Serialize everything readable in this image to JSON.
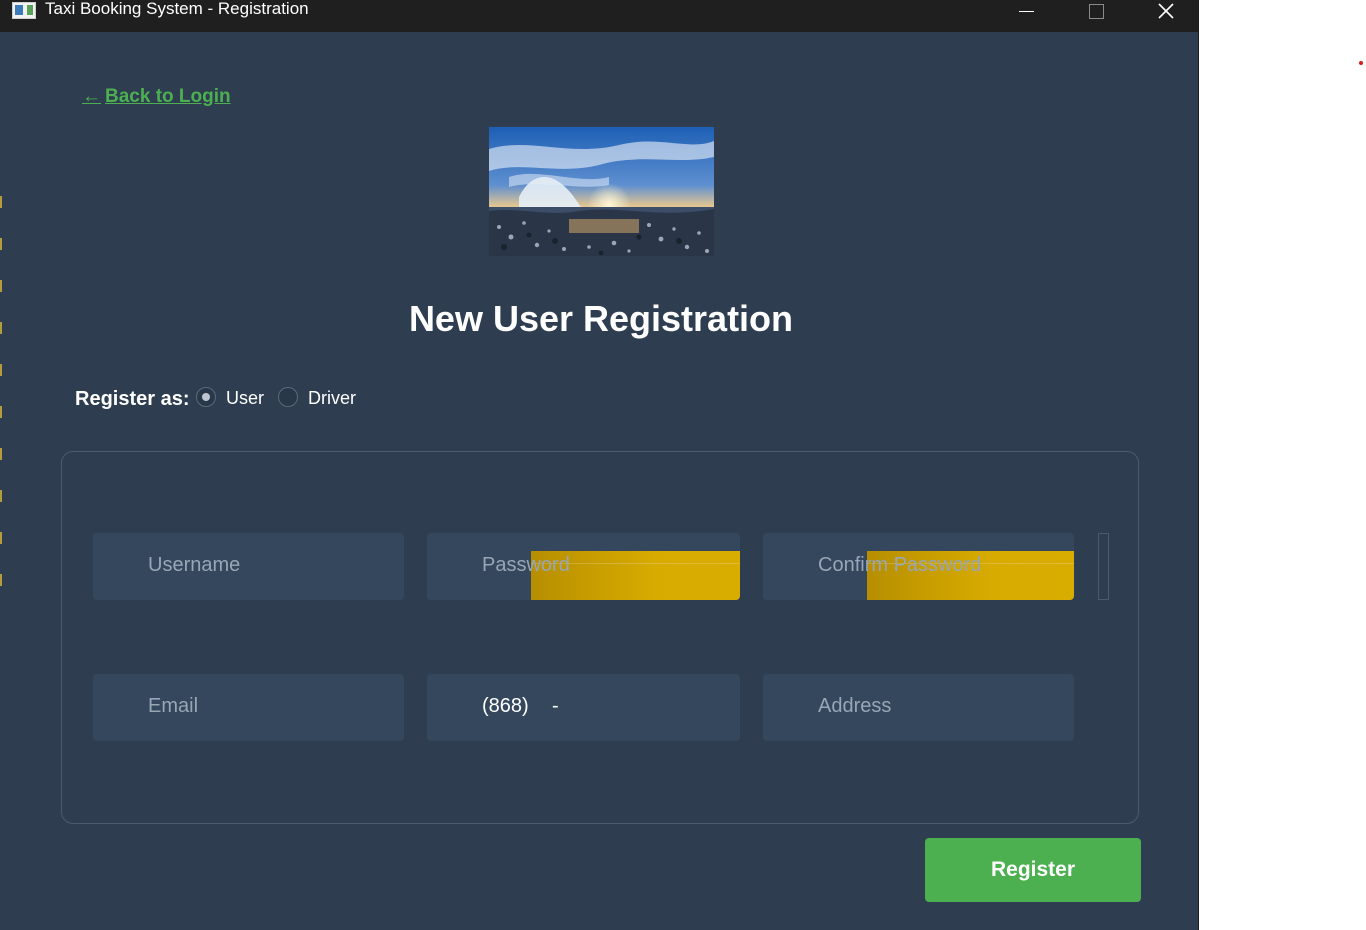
{
  "window": {
    "title": "Taxi Booking System - Registration"
  },
  "nav": {
    "back_arrow": "←",
    "back_label": "Back to Login"
  },
  "header": {
    "title": "New User Registration"
  },
  "role": {
    "label": "Register as:",
    "options": [
      {
        "label": "User",
        "selected": true
      },
      {
        "label": "Driver",
        "selected": false
      }
    ]
  },
  "form": {
    "username_placeholder": "Username",
    "password_placeholder": "Password",
    "confirm_password_placeholder": "Confirm Password",
    "email_placeholder": "Email",
    "phone_value": "(868)",
    "phone_separator": "-",
    "address_placeholder": "Address"
  },
  "actions": {
    "register_label": "Register"
  },
  "colors": {
    "background": "#2e3e50",
    "field": "#34475d",
    "accent_green": "#4caf50",
    "autofill_yellow": "#d7ab00"
  },
  "icons": {
    "app": "app-window-icon",
    "minimize": "minimize-icon",
    "maximize": "maximize-icon",
    "close": "close-icon"
  }
}
